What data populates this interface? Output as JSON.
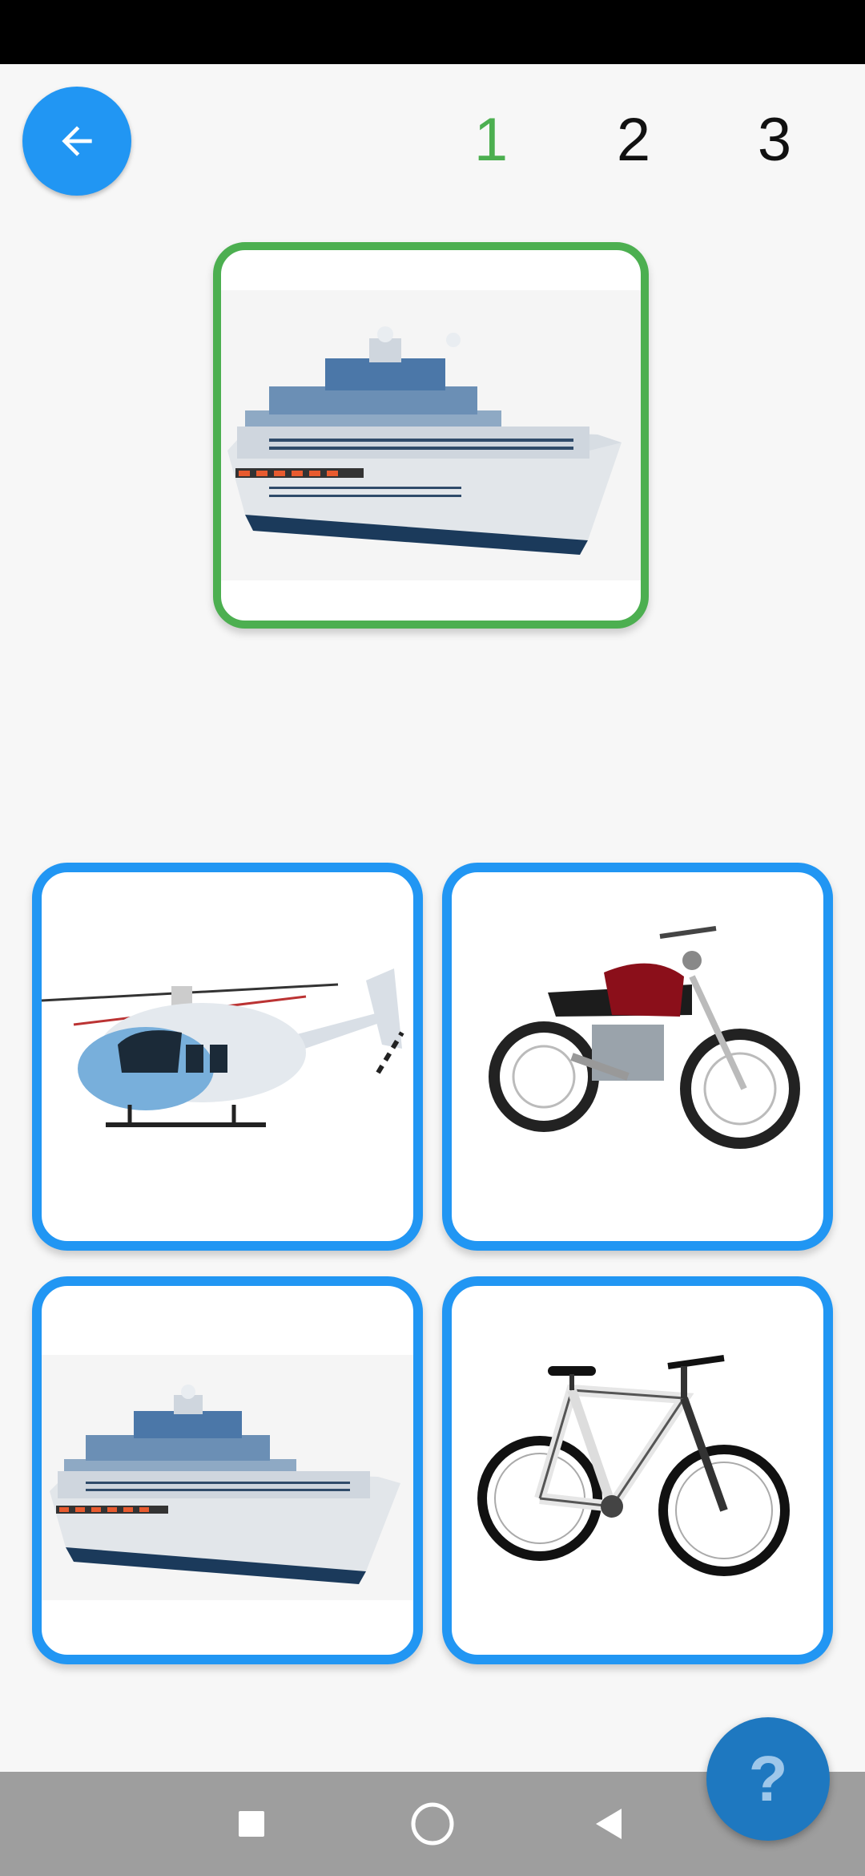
{
  "steps": {
    "items": [
      "1",
      "2",
      "3"
    ],
    "current": 1,
    "active_color": "#4caf50"
  },
  "colors": {
    "primary": "#2196f3",
    "correct": "#4caf50"
  },
  "target": {
    "icon": "cruise-ship-image"
  },
  "options": [
    {
      "icon": "helicopter-image"
    },
    {
      "icon": "motorcycle-image"
    },
    {
      "icon": "cruise-ship-image"
    },
    {
      "icon": "mountain-bike-image"
    }
  ],
  "buttons": {
    "back_icon": "arrow-left-icon",
    "help_label": "?"
  },
  "nav": {
    "recent_icon": "square-icon",
    "home_icon": "circle-icon",
    "back_icon": "triangle-back-icon"
  }
}
